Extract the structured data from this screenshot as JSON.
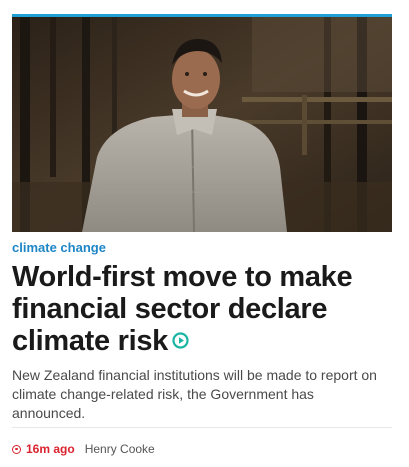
{
  "article": {
    "category": "climate change",
    "headline": "World-first move to make financial sector declare climate risk",
    "summary": "New Zealand financial institutions will be made to report on climate change-related risk, the Government has announced.",
    "time_ago": "16m ago",
    "author": "Henry Cooke",
    "video_icon": "play-circle-icon",
    "time_icon": "live-dot-icon"
  },
  "colors": {
    "accent": "#1f86c6",
    "topline": "#1f9fd6",
    "video": "#1ab5a3",
    "time": "#d9232e",
    "headline": "#1a1a1a",
    "summary": "#4a4a4a"
  }
}
